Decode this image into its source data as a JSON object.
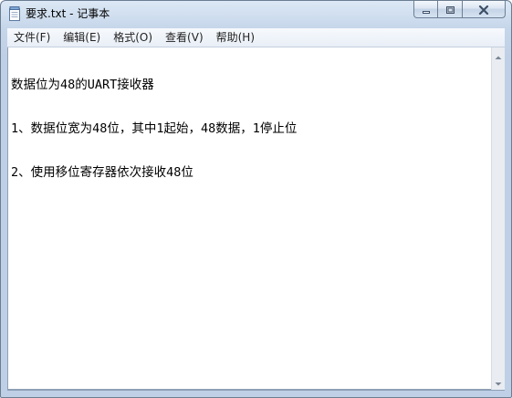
{
  "window": {
    "title": "要求.txt - 记事本",
    "icon": "notepad-icon",
    "caption_buttons": [
      "minimize-icon",
      "maximize-icon",
      "close-icon"
    ]
  },
  "menu": {
    "items": [
      {
        "label": "文件(F)"
      },
      {
        "label": "编辑(E)"
      },
      {
        "label": "格式(O)"
      },
      {
        "label": "查看(V)"
      },
      {
        "label": "帮助(H)"
      }
    ]
  },
  "editor": {
    "lines": [
      "数据位为48的UART接收器",
      "1、数据位宽为48位，其中1起始，48数据，1停止位",
      "2、使用移位寄存器依次接收48位"
    ]
  },
  "colors": {
    "frame": "#bfd0e6",
    "menubar": "#f0f4fa",
    "editor_bg": "#ffffff",
    "text": "#000000"
  }
}
